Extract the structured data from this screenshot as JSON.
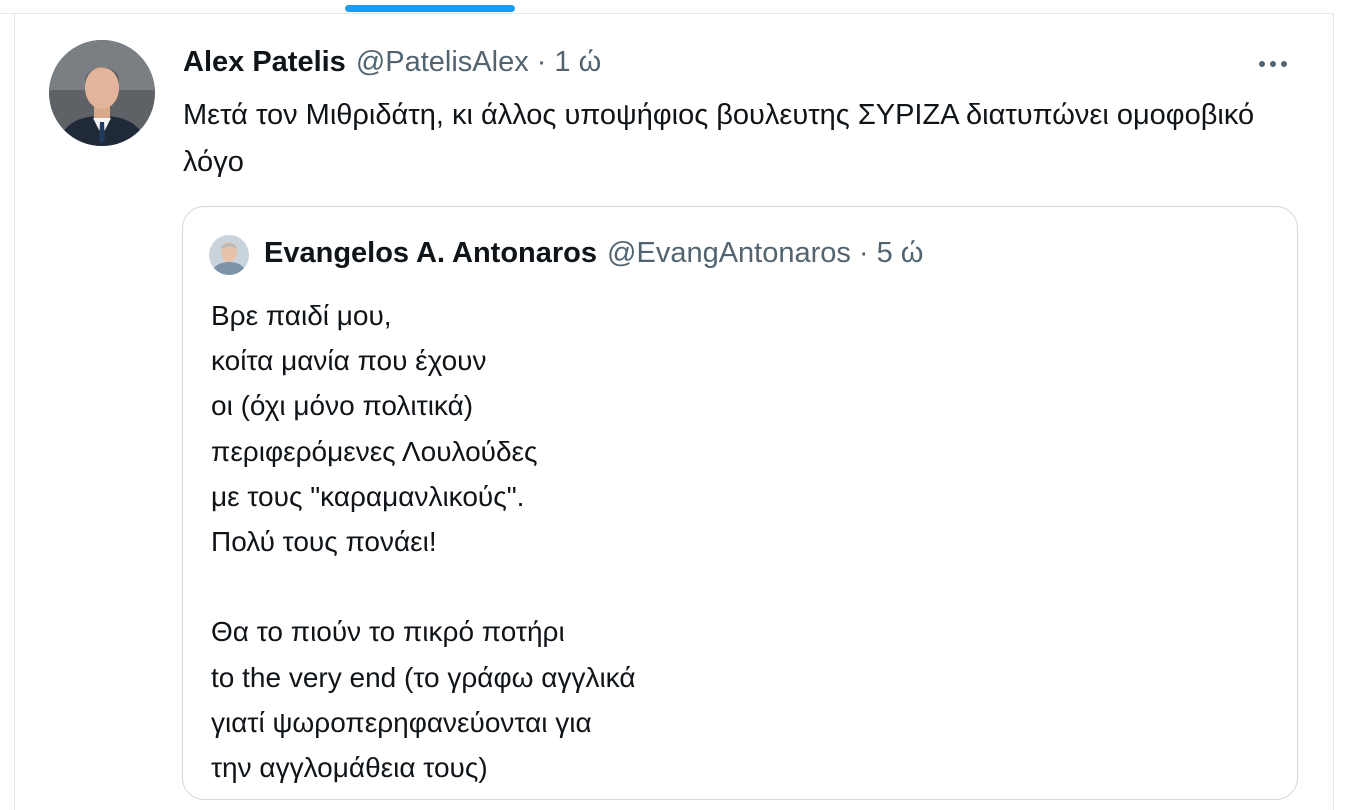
{
  "tweet": {
    "display_name": "Alex Patelis",
    "handle": "@PatelisAlex",
    "separator": "·",
    "time": "1 ώ",
    "text": "Μετά τον Μιθριδάτη, κι άλλος υποψήφιος βουλευτης ΣΥΡΙΖΑ διατυπώνει ομοφοβικό λόγο"
  },
  "quote": {
    "display_name": "Evangelos A. Antonaros",
    "handle": "@EvangAntonaros",
    "separator": "·",
    "time": "5 ώ",
    "lines": [
      "Βρε παιδί μου,",
      "κοίτα μανία που έχουν",
      "οι (όχι μόνο πολιτικά)",
      "περιφερόμενες Λουλούδες",
      "με τους \"καραμανλικούς\".",
      "Πολύ τους πονάει!",
      "",
      "Θα το πιούν το πικρό ποτήρι",
      "to the very end (το γράφω αγγλικά",
      "γιατί ψωροπερηφανεύονται για",
      "την αγγλομάθεια τους)"
    ]
  },
  "colors": {
    "accent": "#1d9bf0",
    "text_primary": "#0f1419",
    "text_secondary": "#536471",
    "border": "#cfd9de"
  },
  "icons": {
    "more": "more-horizontal-icon"
  }
}
